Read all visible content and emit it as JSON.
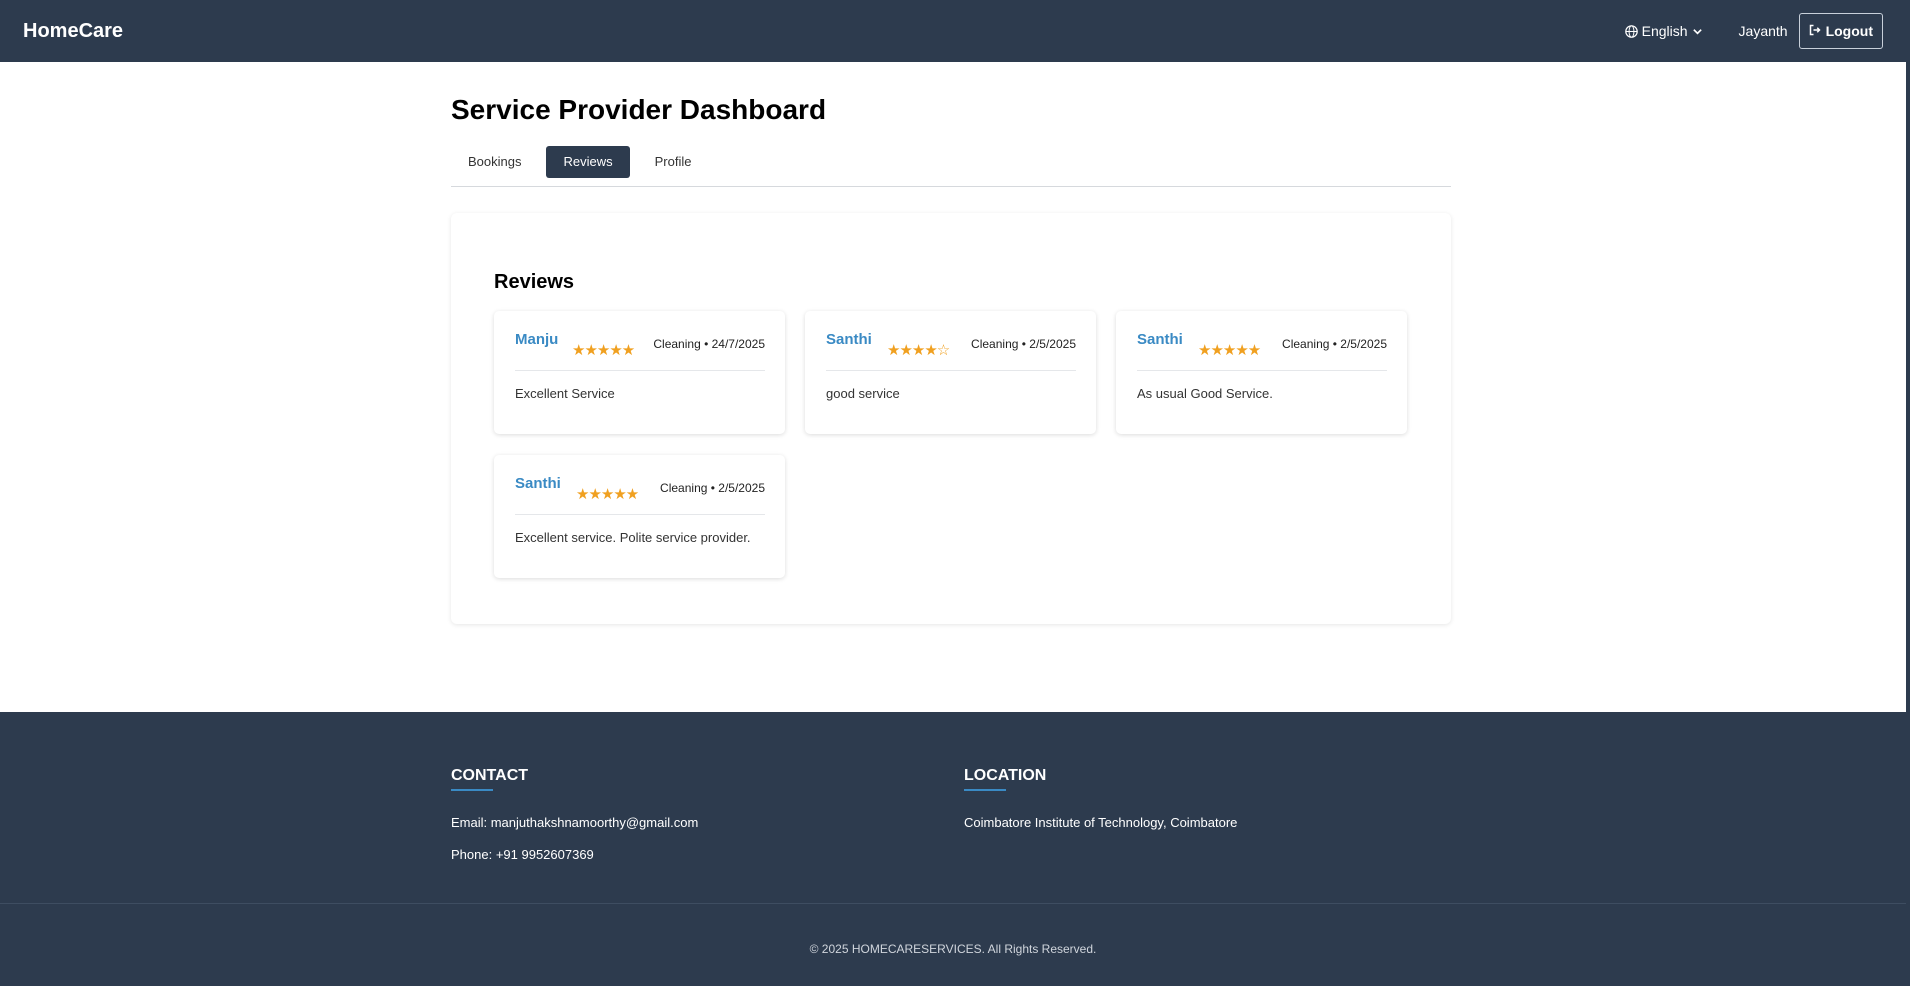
{
  "navbar": {
    "brand": "HomeCare",
    "language": "English",
    "user": "Jayanth",
    "logout_label": "Logout"
  },
  "dashboard": {
    "title": "Service Provider Dashboard",
    "tabs": [
      {
        "label": "Bookings",
        "active": false
      },
      {
        "label": "Reviews",
        "active": true
      },
      {
        "label": "Profile",
        "active": false
      }
    ]
  },
  "reviews": {
    "heading": "Reviews",
    "items": [
      {
        "name": "Manju",
        "stars": "★★★★★",
        "rating": 5,
        "meta": "Cleaning • 24/7/2025",
        "comment": "Excellent Service"
      },
      {
        "name": "Santhi",
        "stars": "★★★★☆",
        "rating": 4,
        "meta": "Cleaning • 2/5/2025",
        "comment": "good service"
      },
      {
        "name": "Santhi",
        "stars": "★★★★★",
        "rating": 5,
        "meta": "Cleaning • 2/5/2025",
        "comment": "As usual Good Service."
      },
      {
        "name": "Santhi",
        "stars": "★★★★★",
        "rating": 5,
        "meta": "Cleaning • 2/5/2025",
        "comment": "Excellent service. Polite service provider."
      }
    ]
  },
  "footer": {
    "contact_heading": "CONTACT",
    "email": "Email: manjuthakshnamoorthy@gmail.com",
    "phone": "Phone: +91 9952607369",
    "location_heading": "LOCATION",
    "location": "Coimbatore Institute of Technology, Coimbatore",
    "copyright": "© 2025 HOMECARESERVICES. All Rights Reserved."
  },
  "colors": {
    "navbar_bg": "#2d3b4e",
    "accent_blue": "#3a8ac4",
    "star_color": "#f0a020"
  },
  "icons": {
    "language": "globe-icon",
    "language_dropdown": "chevron-down-icon",
    "logout": "logout-icon"
  }
}
